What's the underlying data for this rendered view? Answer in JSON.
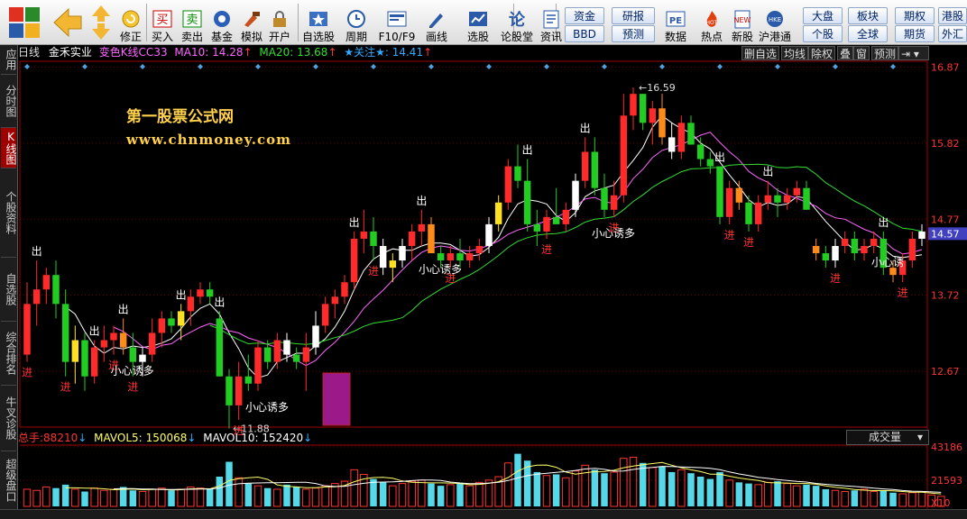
{
  "toolbar": {
    "buttons": [
      {
        "label": "买入",
        "icon": "buy-icon",
        "x": 166
      },
      {
        "label": "卖出",
        "icon": "sell-icon",
        "x": 199
      },
      {
        "label": "基金",
        "icon": "fund-icon",
        "x": 232
      },
      {
        "label": "模拟",
        "icon": "simulate-icon",
        "x": 265
      },
      {
        "label": "开户",
        "icon": "lock-icon",
        "x": 296
      }
    ],
    "left_buttons": [
      {
        "label": "修正",
        "icon": "fix-icon"
      }
    ],
    "group2": [
      {
        "label": "自选股",
        "icon": "star-icon"
      },
      {
        "label": "周期",
        "icon": "clock-icon"
      },
      {
        "label": "F10/F9",
        "icon": "f10-icon"
      },
      {
        "label": "画线",
        "icon": "pen-icon"
      },
      {
        "label": "选股",
        "icon": "picker-icon"
      },
      {
        "label": "论股堂",
        "icon": "forum-icon"
      },
      {
        "label": "资讯",
        "icon": "news-icon"
      }
    ],
    "mini": [
      {
        "label": "资金"
      },
      {
        "label": "BBD"
      },
      {
        "label": "研报"
      },
      {
        "label": "预测"
      }
    ],
    "group3": [
      {
        "label": "数据",
        "icon": "pe-icon",
        "badge": "PE"
      },
      {
        "label": "热点",
        "icon": "hot-icon"
      },
      {
        "label": "新股",
        "icon": "new-stock-icon"
      },
      {
        "label": "沪港通",
        "icon": "hk-icon"
      }
    ],
    "right_mini": [
      {
        "label": "大盘"
      },
      {
        "label": "板块"
      },
      {
        "label": "期权"
      },
      {
        "label": "港股"
      },
      {
        "label": "个股"
      },
      {
        "label": "全球"
      },
      {
        "label": "期货"
      },
      {
        "label": "外汇"
      }
    ]
  },
  "sidebar": {
    "items": [
      {
        "label": "应用",
        "active": false
      },
      {
        "label": "分时图",
        "active": false
      },
      {
        "label": "K线图",
        "active": true
      },
      {
        "label": "个股资料",
        "active": false
      },
      {
        "label": "自选股",
        "active": false
      },
      {
        "label": "综合排名",
        "active": false
      },
      {
        "label": "牛叉诊股",
        "active": false
      },
      {
        "label": "超级盘口",
        "active": false
      }
    ]
  },
  "infobar": {
    "period": "日线",
    "stock": "金禾实业",
    "indicator": "变色K线CC33",
    "ma10_label": "MA10:",
    "ma10_value": "14.28",
    "ma20_label": "MA20:",
    "ma20_value": "13.68",
    "focus_label": "★关注★:",
    "focus_value": "14.41",
    "up_arrow": "↑",
    "colors": {
      "period": "#dddddd",
      "stock": "#ffffff",
      "indicator": "#ff66ff",
      "ma10": "#ff66ff",
      "ma20": "#33dd33",
      "focus": "#33aaff",
      "arrow": "#ff3333"
    }
  },
  "chart_buttons": [
    "删自选",
    "均线",
    "除权",
    "叠",
    "窗",
    "预测"
  ],
  "watermark": {
    "line1": "第一股票公式网",
    "line2": "www.chnmoney.com"
  },
  "chart_data": {
    "type": "candlestick",
    "price_axis": {
      "ticks": [
        "16.87",
        "15.82",
        "14.77",
        "13.72",
        "12.67"
      ],
      "current": "14.57"
    },
    "ylim": [
      11.9,
      16.95
    ],
    "high_label": "16.59",
    "low_label": "11.88",
    "candles": [
      {
        "o": 12.9,
        "h": 13.9,
        "l": 12.8,
        "c": 13.6
      },
      {
        "o": 13.6,
        "h": 14.2,
        "l": 13.3,
        "c": 13.8
      },
      {
        "o": 13.8,
        "h": 14.1,
        "l": 13.6,
        "c": 14.0
      },
      {
        "o": 14.0,
        "h": 14.2,
        "l": 13.4,
        "c": 13.6
      },
      {
        "o": 13.6,
        "h": 13.8,
        "l": 12.6,
        "c": 12.8
      },
      {
        "o": 12.8,
        "h": 13.3,
        "l": 12.5,
        "c": 13.1
      },
      {
        "o": 13.1,
        "h": 13.2,
        "l": 12.4,
        "c": 12.6
      },
      {
        "o": 12.6,
        "h": 13.1,
        "l": 12.5,
        "c": 13.0
      },
      {
        "o": 13.0,
        "h": 13.3,
        "l": 12.8,
        "c": 13.1
      },
      {
        "o": 13.1,
        "h": 13.3,
        "l": 12.9,
        "c": 13.2
      },
      {
        "o": 13.2,
        "h": 13.4,
        "l": 12.9,
        "c": 13.0
      },
      {
        "o": 13.0,
        "h": 13.2,
        "l": 12.6,
        "c": 12.8
      },
      {
        "o": 12.8,
        "h": 13.0,
        "l": 12.6,
        "c": 12.9
      },
      {
        "o": 12.9,
        "h": 13.4,
        "l": 12.8,
        "c": 13.2
      },
      {
        "o": 13.2,
        "h": 13.5,
        "l": 13.0,
        "c": 13.4
      },
      {
        "o": 13.4,
        "h": 13.5,
        "l": 13.2,
        "c": 13.3
      },
      {
        "o": 13.3,
        "h": 13.6,
        "l": 13.1,
        "c": 13.5
      },
      {
        "o": 13.5,
        "h": 13.8,
        "l": 13.3,
        "c": 13.7
      },
      {
        "o": 13.7,
        "h": 13.9,
        "l": 13.6,
        "c": 13.8
      },
      {
        "o": 13.8,
        "h": 13.9,
        "l": 13.6,
        "c": 13.7
      },
      {
        "o": 13.4,
        "h": 13.5,
        "l": 12.6,
        "c": 12.6
      },
      {
        "o": 12.6,
        "h": 12.7,
        "l": 11.88,
        "c": 12.2
      },
      {
        "o": 12.2,
        "h": 12.8,
        "l": 12.0,
        "c": 12.6
      },
      {
        "o": 12.6,
        "h": 12.9,
        "l": 12.4,
        "c": 12.5
      },
      {
        "o": 12.5,
        "h": 13.1,
        "l": 12.4,
        "c": 13.0
      },
      {
        "o": 13.0,
        "h": 13.1,
        "l": 12.7,
        "c": 12.8
      },
      {
        "o": 12.8,
        "h": 13.2,
        "l": 12.7,
        "c": 13.1
      },
      {
        "o": 13.1,
        "h": 13.2,
        "l": 12.8,
        "c": 12.9
      },
      {
        "o": 12.9,
        "h": 13.0,
        "l": 12.7,
        "c": 12.8
      },
      {
        "o": 12.8,
        "h": 13.2,
        "l": 12.4,
        "c": 13.0
      },
      {
        "o": 13.0,
        "h": 13.5,
        "l": 12.9,
        "c": 13.3
      },
      {
        "o": 13.3,
        "h": 13.7,
        "l": 13.2,
        "c": 13.6
      },
      {
        "o": 13.6,
        "h": 13.8,
        "l": 13.4,
        "c": 13.7
      },
      {
        "o": 13.7,
        "h": 14.0,
        "l": 13.6,
        "c": 13.9
      },
      {
        "o": 13.9,
        "h": 14.6,
        "l": 13.8,
        "c": 14.5
      },
      {
        "o": 14.5,
        "h": 14.9,
        "l": 14.3,
        "c": 14.6
      },
      {
        "o": 14.6,
        "h": 14.8,
        "l": 14.2,
        "c": 14.4
      },
      {
        "o": 14.4,
        "h": 14.5,
        "l": 14.0,
        "c": 14.1
      },
      {
        "o": 14.1,
        "h": 14.3,
        "l": 13.9,
        "c": 14.2
      },
      {
        "o": 14.2,
        "h": 14.5,
        "l": 14.1,
        "c": 14.4
      },
      {
        "o": 14.4,
        "h": 14.7,
        "l": 14.2,
        "c": 14.6
      },
      {
        "o": 14.6,
        "h": 14.9,
        "l": 14.4,
        "c": 14.7
      },
      {
        "o": 14.7,
        "h": 14.8,
        "l": 14.3,
        "c": 14.3
      },
      {
        "o": 14.3,
        "h": 14.4,
        "l": 14.1,
        "c": 14.2
      },
      {
        "o": 14.2,
        "h": 14.4,
        "l": 14.1,
        "c": 14.3
      },
      {
        "o": 14.3,
        "h": 14.5,
        "l": 14.1,
        "c": 14.2
      },
      {
        "o": 14.2,
        "h": 14.4,
        "l": 14.1,
        "c": 14.3
      },
      {
        "o": 14.3,
        "h": 14.5,
        "l": 14.2,
        "c": 14.4
      },
      {
        "o": 14.4,
        "h": 14.8,
        "l": 14.3,
        "c": 14.7
      },
      {
        "o": 14.7,
        "h": 15.1,
        "l": 14.6,
        "c": 15.0
      },
      {
        "o": 15.0,
        "h": 15.6,
        "l": 14.9,
        "c": 15.5
      },
      {
        "o": 15.5,
        "h": 15.8,
        "l": 15.2,
        "c": 15.3
      },
      {
        "o": 15.3,
        "h": 15.6,
        "l": 14.6,
        "c": 14.7
      },
      {
        "o": 14.7,
        "h": 14.9,
        "l": 14.4,
        "c": 14.6
      },
      {
        "o": 14.6,
        "h": 14.9,
        "l": 14.5,
        "c": 14.8
      },
      {
        "o": 14.8,
        "h": 15.2,
        "l": 14.7,
        "c": 14.7
      },
      {
        "o": 14.7,
        "h": 15.0,
        "l": 14.6,
        "c": 14.9
      },
      {
        "o": 14.9,
        "h": 15.4,
        "l": 14.8,
        "c": 15.3
      },
      {
        "o": 15.3,
        "h": 15.9,
        "l": 15.2,
        "c": 15.7
      },
      {
        "o": 15.7,
        "h": 15.9,
        "l": 15.1,
        "c": 15.2
      },
      {
        "o": 15.2,
        "h": 15.4,
        "l": 14.8,
        "c": 14.9
      },
      {
        "o": 14.9,
        "h": 15.3,
        "l": 14.8,
        "c": 15.1
      },
      {
        "o": 15.1,
        "h": 16.5,
        "l": 15.0,
        "c": 16.2
      },
      {
        "o": 16.2,
        "h": 16.59,
        "l": 16.0,
        "c": 16.5
      },
      {
        "o": 16.5,
        "h": 16.5,
        "l": 16.0,
        "c": 16.1
      },
      {
        "o": 16.1,
        "h": 16.4,
        "l": 15.8,
        "c": 16.3
      },
      {
        "o": 16.3,
        "h": 16.5,
        "l": 15.8,
        "c": 15.9
      },
      {
        "o": 15.9,
        "h": 16.1,
        "l": 15.6,
        "c": 15.7
      },
      {
        "o": 15.7,
        "h": 16.2,
        "l": 15.6,
        "c": 16.1
      },
      {
        "o": 16.1,
        "h": 16.2,
        "l": 15.8,
        "c": 15.8
      },
      {
        "o": 15.8,
        "h": 15.9,
        "l": 15.5,
        "c": 15.6
      },
      {
        "o": 15.6,
        "h": 15.7,
        "l": 15.4,
        "c": 15.5
      },
      {
        "o": 15.5,
        "h": 15.5,
        "l": 14.7,
        "c": 14.8
      },
      {
        "o": 14.8,
        "h": 15.3,
        "l": 14.7,
        "c": 15.2
      },
      {
        "o": 15.2,
        "h": 15.3,
        "l": 14.9,
        "c": 15.0
      },
      {
        "o": 15.0,
        "h": 15.1,
        "l": 14.6,
        "c": 14.7
      },
      {
        "o": 14.7,
        "h": 15.1,
        "l": 14.6,
        "c": 15.0
      },
      {
        "o": 15.0,
        "h": 15.3,
        "l": 14.9,
        "c": 15.1
      },
      {
        "o": 15.1,
        "h": 15.2,
        "l": 14.8,
        "c": 15.0
      },
      {
        "o": 15.0,
        "h": 15.2,
        "l": 14.9,
        "c": 15.1
      },
      {
        "o": 15.1,
        "h": 15.3,
        "l": 15.0,
        "c": 15.2
      },
      {
        "o": 15.2,
        "h": 15.3,
        "l": 14.9,
        "c": 14.9
      },
      {
        "o": 14.4,
        "h": 14.5,
        "l": 14.2,
        "c": 14.3
      },
      {
        "o": 14.3,
        "h": 14.4,
        "l": 14.1,
        "c": 14.2
      },
      {
        "o": 14.2,
        "h": 14.5,
        "l": 14.1,
        "c": 14.4
      },
      {
        "o": 14.4,
        "h": 14.6,
        "l": 14.3,
        "c": 14.5
      },
      {
        "o": 14.5,
        "h": 14.6,
        "l": 14.2,
        "c": 14.3
      },
      {
        "o": 14.3,
        "h": 14.5,
        "l": 14.2,
        "c": 14.4
      },
      {
        "o": 14.4,
        "h": 14.6,
        "l": 14.3,
        "c": 14.5
      },
      {
        "o": 14.5,
        "h": 14.6,
        "l": 14.0,
        "c": 14.1
      },
      {
        "o": 14.1,
        "h": 14.2,
        "l": 13.9,
        "c": 14.0
      },
      {
        "o": 14.0,
        "h": 14.3,
        "l": 13.9,
        "c": 14.2
      },
      {
        "o": 14.2,
        "h": 14.6,
        "l": 14.1,
        "c": 14.5
      },
      {
        "o": 14.5,
        "h": 14.7,
        "l": 14.4,
        "c": 14.6
      }
    ],
    "signals": [
      {
        "i": 1,
        "text": "出",
        "where": "high"
      },
      {
        "i": 0,
        "text": "进",
        "where": "low"
      },
      {
        "i": 4,
        "text": "进",
        "where": "low"
      },
      {
        "i": 7,
        "text": "出",
        "where": "high"
      },
      {
        "i": 9,
        "text": "进",
        "where": "low"
      },
      {
        "i": 11,
        "text": "进",
        "where": "low"
      },
      {
        "i": 10,
        "text": "出",
        "where": "high"
      },
      {
        "i": 16,
        "text": "出",
        "where": "high"
      },
      {
        "i": 22,
        "text": "进",
        "where": "low"
      },
      {
        "i": 20,
        "text": "出",
        "where": "high"
      },
      {
        "i": 34,
        "text": "出",
        "where": "high"
      },
      {
        "i": 36,
        "text": "进",
        "where": "low"
      },
      {
        "i": 41,
        "text": "出",
        "where": "high"
      },
      {
        "i": 44,
        "text": "进",
        "where": "low"
      },
      {
        "i": 52,
        "text": "出",
        "where": "high"
      },
      {
        "i": 54,
        "text": "进",
        "where": "low"
      },
      {
        "i": 58,
        "text": "出",
        "where": "high"
      },
      {
        "i": 61,
        "text": "进",
        "where": "low"
      },
      {
        "i": 72,
        "text": "出",
        "where": "high"
      },
      {
        "i": 73,
        "text": "进",
        "where": "low"
      },
      {
        "i": 75,
        "text": "进",
        "where": "low"
      },
      {
        "i": 77,
        "text": "出",
        "where": "high"
      },
      {
        "i": 84,
        "text": "进",
        "where": "low"
      },
      {
        "i": 89,
        "text": "出",
        "where": "high"
      },
      {
        "i": 91,
        "text": "进",
        "where": "low"
      }
    ],
    "warnings": [
      {
        "i": 10,
        "text": "小心诱多"
      },
      {
        "i": 24,
        "text": "小心诱多"
      },
      {
        "i": 42,
        "text": "小心诱多"
      },
      {
        "i": 60,
        "text": "小心诱多"
      },
      {
        "i": 93,
        "text": "小心诱"
      }
    ],
    "volume": {
      "header_label": "总手:",
      "header_value": "88210",
      "mavol5_label": "MAVOL5:",
      "mavol5_value": "150068",
      "mavol10_label": "MAVOL10:",
      "mavol10_value": "152420",
      "down_arrow": "↓",
      "selector": "成交量",
      "ticks": [
        "43186",
        "21593",
        "X10"
      ],
      "ylim": [
        0,
        520000
      ],
      "values": [
        150000,
        140000,
        170000,
        160000,
        190000,
        150000,
        130000,
        160000,
        140000,
        150000,
        170000,
        140000,
        130000,
        150000,
        160000,
        140000,
        150000,
        170000,
        160000,
        150000,
        260000,
        390000,
        250000,
        200000,
        180000,
        160000,
        150000,
        190000,
        170000,
        150000,
        160000,
        180000,
        200000,
        220000,
        320000,
        280000,
        240000,
        210000,
        180000,
        200000,
        220000,
        230000,
        200000,
        180000,
        190000,
        200000,
        180000,
        210000,
        230000,
        260000,
        380000,
        460000,
        400000,
        300000,
        270000,
        280000,
        250000,
        310000,
        360000,
        320000,
        290000,
        300000,
        420000,
        430000,
        380000,
        340000,
        350000,
        300000,
        320000,
        290000,
        260000,
        240000,
        300000,
        230000,
        210000,
        200000,
        190000,
        210000,
        220000,
        200000,
        180000,
        190000,
        180000,
        150000,
        140000,
        130000,
        140000,
        150000,
        130000,
        140000,
        120000,
        110000,
        120000,
        130000,
        100000,
        88210
      ]
    }
  }
}
